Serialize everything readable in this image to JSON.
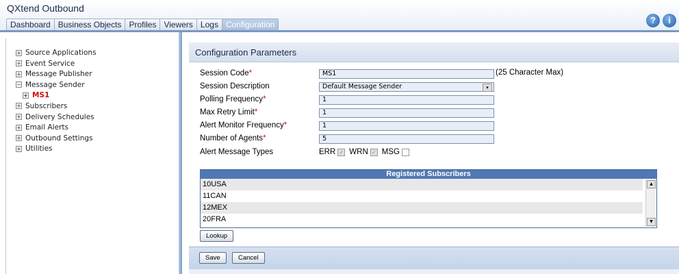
{
  "app": {
    "title": "QXtend Outbound"
  },
  "tabs": [
    {
      "label": "Dashboard"
    },
    {
      "label": "Business Objects"
    },
    {
      "label": "Profiles"
    },
    {
      "label": "Viewers"
    },
    {
      "label": "Logs"
    },
    {
      "label": "Configuration",
      "active": true
    }
  ],
  "header_icons": {
    "help": "?",
    "info": "i"
  },
  "sidebar": {
    "items": [
      {
        "label": "Source Applications",
        "expander": "+"
      },
      {
        "label": "Event Service",
        "expander": "+"
      },
      {
        "label": "Message Publisher",
        "expander": "+"
      },
      {
        "label": "Message Sender",
        "expander": "−"
      },
      {
        "label": "MS1",
        "expander": "+",
        "selected": true
      },
      {
        "label": "Subscribers",
        "expander": "+"
      },
      {
        "label": "Delivery Schedules",
        "expander": "+"
      },
      {
        "label": "Email Alerts",
        "expander": "+"
      },
      {
        "label": "Outbound Settings",
        "expander": "+"
      },
      {
        "label": "Utilities",
        "expander": "+"
      }
    ]
  },
  "panel": {
    "title": "Configuration Parameters",
    "fields": {
      "session_code": {
        "label": "Session Code",
        "value": "MS1",
        "hint": "(25 Character Max)"
      },
      "session_description": {
        "label": "Session Description",
        "value": "Default Message Sender"
      },
      "polling_frequency": {
        "label": "Polling Frequency",
        "value": "1"
      },
      "max_retry_limit": {
        "label": "Max Retry Limit",
        "value": "1"
      },
      "alert_monitor_frequency": {
        "label": "Alert Monitor Frequency",
        "value": "1"
      },
      "number_of_agents": {
        "label": "Number of Agents",
        "value": "5"
      },
      "alert_message_types": {
        "label": "Alert Message Types",
        "options": [
          {
            "label": "ERR",
            "checked": true
          },
          {
            "label": "WRN",
            "checked": true
          },
          {
            "label": "MSG",
            "checked": false
          }
        ]
      }
    },
    "required_marker": "*",
    "subscribers": {
      "title": "Registered Subscribers",
      "rows": [
        "10USA",
        "11CAN",
        "12MEX",
        "20FRA"
      ]
    },
    "lookup_label": "Lookup",
    "save_label": "Save",
    "cancel_label": "Cancel"
  },
  "colors": {
    "accent": "#4f79b4",
    "required": "#d01010",
    "panel_bg": "#eaf0f8"
  }
}
